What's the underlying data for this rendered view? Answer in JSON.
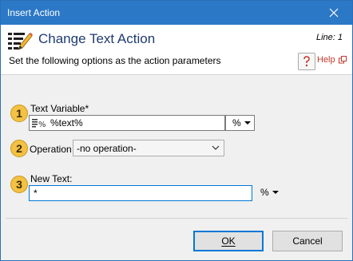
{
  "window": {
    "title": "Insert Action"
  },
  "header": {
    "action_title": "Change Text Action",
    "line_label": "Line: 1",
    "subtitle": "Set the following options as the action parameters",
    "help_label": "Help"
  },
  "fields": {
    "text_variable": {
      "badge": "1",
      "label": "Text Variable*",
      "value": "%text%",
      "pct_label": "%"
    },
    "operation": {
      "badge": "2",
      "label": "Operation",
      "selected": "-no operation-"
    },
    "new_text": {
      "badge": "3",
      "label": "New Text:",
      "value": "*",
      "pct_label": "%"
    }
  },
  "buttons": {
    "ok_label": "OK",
    "cancel_label": "Cancel"
  },
  "colors": {
    "titlebar": "#2b78c6",
    "badge": "#f3c143",
    "focus_border": "#0078d7",
    "help_text": "#c0392b"
  },
  "icons": [
    "close-icon",
    "action-edit-icon",
    "help-icon",
    "popout-icon",
    "variable-icon",
    "dropdown-arrow-icon",
    "chevron-down-icon"
  ]
}
